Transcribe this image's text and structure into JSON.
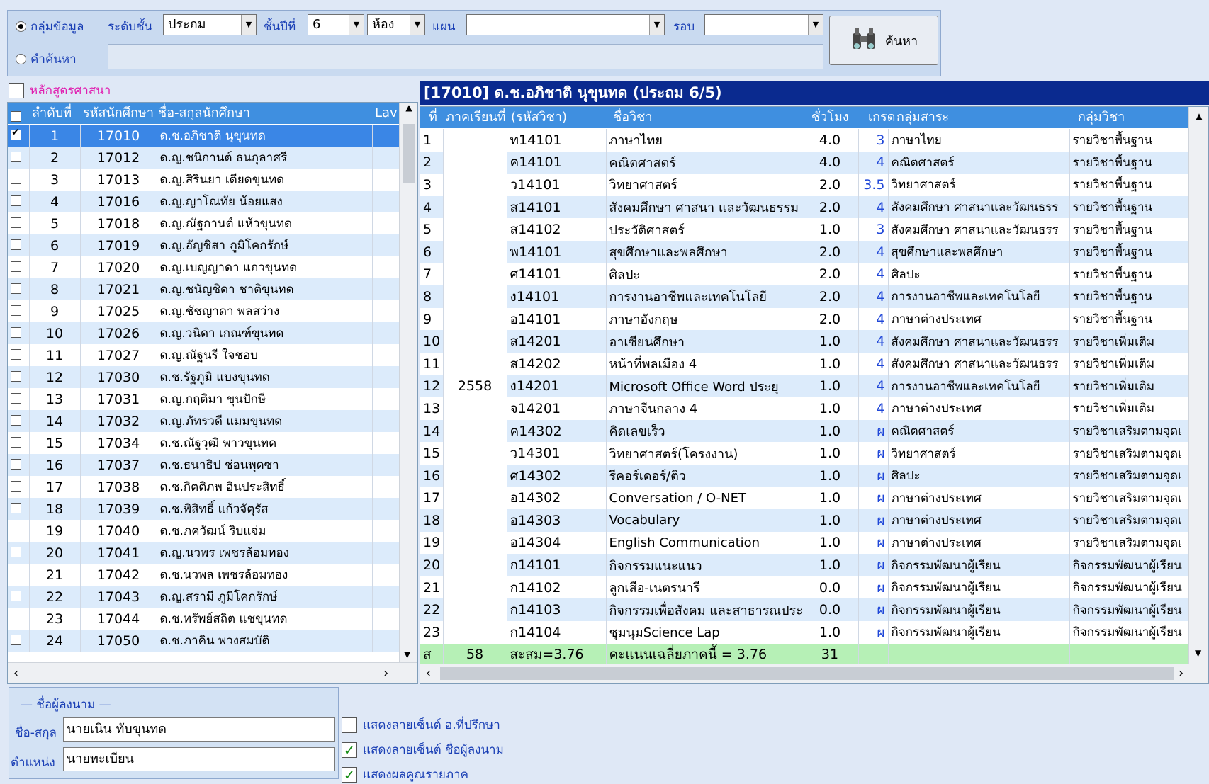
{
  "filter": {
    "group_radio": "กลุ่มข้อมูล",
    "level_label": "ระดับชั้น",
    "level_value": "ประถม",
    "grade_label": "ชั้นปีที่",
    "grade_value": "6",
    "room_value": "ห้อง",
    "plan_label": "แผน",
    "plan_value": "",
    "round_label": "รอบ",
    "round_value": "",
    "keyword_radio": "คำค้นหา",
    "keyword_value": "",
    "search_button": "ค้นหา"
  },
  "left": {
    "religion_check": "หลักสูตรศาสนา",
    "headers": [
      "ลำดับที่",
      "รหัสนักศึกษา",
      "ชื่อ-สกุลนักศึกษา",
      "Lav"
    ],
    "students": [
      {
        "no": "1",
        "id": "17010",
        "name": "ด.ช.อภิชาติ นุขุนทด",
        "checked": true
      },
      {
        "no": "2",
        "id": "17012",
        "name": "ด.ญ.ชนิกานต์ ธนกุลาศรี",
        "checked": false
      },
      {
        "no": "3",
        "id": "17013",
        "name": "ด.ญ.สิรินยา เตียดขุนทด",
        "checked": false
      },
      {
        "no": "4",
        "id": "17016",
        "name": "ด.ญ.ญาโณทัย น้อยแสง",
        "checked": false
      },
      {
        "no": "5",
        "id": "17018",
        "name": "ด.ญ.ณัฐกานต์ แห้วขุนทด",
        "checked": false
      },
      {
        "no": "6",
        "id": "17019",
        "name": "ด.ญ.อัญชิสา ภูมิโคกรักษ์",
        "checked": false
      },
      {
        "no": "7",
        "id": "17020",
        "name": "ด.ญ.เบญญาดา แถวขุนทด",
        "checked": false
      },
      {
        "no": "8",
        "id": "17021",
        "name": "ด.ญ.ชนัญชิดา ชาติขุนทด",
        "checked": false
      },
      {
        "no": "9",
        "id": "17025",
        "name": "ด.ญ.ชัชญาดา พลสว่าง",
        "checked": false
      },
      {
        "no": "10",
        "id": "17026",
        "name": "ด.ญ.วนิดา เกณฑ์ขุนทด",
        "checked": false
      },
      {
        "no": "11",
        "id": "17027",
        "name": "ด.ญ.ณัฐนรี ใจชอบ",
        "checked": false
      },
      {
        "no": "12",
        "id": "17030",
        "name": "ด.ช.รัฐภูมิ แบงขุนทด",
        "checked": false
      },
      {
        "no": "13",
        "id": "17031",
        "name": "ด.ญ.กฤติมา ขุนปักษี",
        "checked": false
      },
      {
        "no": "14",
        "id": "17032",
        "name": "ด.ญ.ภัทรวดี แมมขุนทด",
        "checked": false
      },
      {
        "no": "15",
        "id": "17034",
        "name": "ด.ช.ณัฐวุฒิ พาวขุนทด",
        "checked": false
      },
      {
        "no": "16",
        "id": "17037",
        "name": "ด.ช.ธนาธิป ช่อนพุดซา",
        "checked": false
      },
      {
        "no": "17",
        "id": "17038",
        "name": "ด.ช.กิตติภพ อินประสิทธิ์",
        "checked": false
      },
      {
        "no": "18",
        "id": "17039",
        "name": "ด.ช.พิสิทธิ์ แก้วจัตุรัส",
        "checked": false
      },
      {
        "no": "19",
        "id": "17040",
        "name": "ด.ช.ภควัฒน์ ริบแจ่ม",
        "checked": false
      },
      {
        "no": "20",
        "id": "17041",
        "name": "ด.ญ.นวพร เพชรล้อมทอง",
        "checked": false
      },
      {
        "no": "21",
        "id": "17042",
        "name": "ด.ช.นวพล เพชรล้อมทอง",
        "checked": false
      },
      {
        "no": "22",
        "id": "17043",
        "name": "ด.ญ.สรามี ภูมิโคกรักษ์",
        "checked": false
      },
      {
        "no": "23",
        "id": "17044",
        "name": "ด.ช.ทรัพย์สถิต แชขุนทด",
        "checked": false
      },
      {
        "no": "24",
        "id": "17050",
        "name": "ด.ช.ภาคิน พวงสมบัติ",
        "checked": false
      }
    ]
  },
  "right": {
    "title": "[17010] ด.ช.อภิชาติ นุขุนทด (ประถม 6/5)",
    "headers": [
      "ที่",
      "ภาคเรียนที่",
      "(รหัสวิชา)",
      "ชื่อวิชา",
      "ชั่วโมง",
      "เกรด",
      "กลุ่มสาระ",
      "กลุ่มวิชา"
    ],
    "year": "2558",
    "rows": [
      {
        "no": "1",
        "code": "ท14101",
        "name": "ภาษาไทย",
        "hours": "4.0",
        "grade": "3",
        "area": "ภาษาไทย",
        "group": "รายวิชาพื้นฐาน"
      },
      {
        "no": "2",
        "code": "ค14101",
        "name": "คณิตศาสตร์",
        "hours": "4.0",
        "grade": "4",
        "area": "คณิตศาสตร์",
        "group": "รายวิชาพื้นฐาน"
      },
      {
        "no": "3",
        "code": "ว14101",
        "name": "วิทยาศาสตร์",
        "hours": "2.0",
        "grade": "3.5",
        "area": "วิทยาศาสตร์",
        "group": "รายวิชาพื้นฐาน"
      },
      {
        "no": "4",
        "code": "ส14101",
        "name": "สังคมศึกษา ศาสนา และวัฒนธรรม",
        "hours": "2.0",
        "grade": "4",
        "area": "สังคมศึกษา ศาสนาและวัฒนธรร",
        "group": "รายวิชาพื้นฐาน"
      },
      {
        "no": "5",
        "code": "ส14102",
        "name": "ประวัติศาสตร์",
        "hours": "1.0",
        "grade": "3",
        "area": "สังคมศึกษา ศาสนาและวัฒนธรร",
        "group": "รายวิชาพื้นฐาน"
      },
      {
        "no": "6",
        "code": "พ14101",
        "name": "สุขศึกษาและพลศึกษา",
        "hours": "2.0",
        "grade": "4",
        "area": "สุขศึกษาและพลศึกษา",
        "group": "รายวิชาพื้นฐาน"
      },
      {
        "no": "7",
        "code": "ศ14101",
        "name": "ศิลปะ",
        "hours": "2.0",
        "grade": "4",
        "area": "ศิลปะ",
        "group": "รายวิชาพื้นฐาน"
      },
      {
        "no": "8",
        "code": "ง14101",
        "name": "การงานอาชีพและเทคโนโลยี",
        "hours": "2.0",
        "grade": "4",
        "area": "การงานอาชีพและเทคโนโลยี",
        "group": "รายวิชาพื้นฐาน"
      },
      {
        "no": "9",
        "code": "อ14101",
        "name": "ภาษาอังกฤษ",
        "hours": "2.0",
        "grade": "4",
        "area": "ภาษาต่างประเทศ",
        "group": "รายวิชาพื้นฐาน"
      },
      {
        "no": "10",
        "code": "ส14201",
        "name": "อาเซียนศึกษา",
        "hours": "1.0",
        "grade": "4",
        "area": "สังคมศึกษา ศาสนาและวัฒนธรร",
        "group": "รายวิชาเพิ่มเติม"
      },
      {
        "no": "11",
        "code": "ส14202",
        "name": "หน้าที่พลเมือง 4",
        "hours": "1.0",
        "grade": "4",
        "area": "สังคมศึกษา ศาสนาและวัฒนธรร",
        "group": "รายวิชาเพิ่มเติม"
      },
      {
        "no": "12",
        "code": "ง14201",
        "name": "Microsoft Office Word ประยุ",
        "hours": "1.0",
        "grade": "4",
        "area": "การงานอาชีพและเทคโนโลยี",
        "group": "รายวิชาเพิ่มเติม"
      },
      {
        "no": "13",
        "code": "จ14201",
        "name": "ภาษาจีนกลาง 4",
        "hours": "1.0",
        "grade": "4",
        "area": "ภาษาต่างประเทศ",
        "group": "รายวิชาเพิ่มเติม"
      },
      {
        "no": "14",
        "code": "ค14302",
        "name": "คิดเลขเร็ว",
        "hours": "1.0",
        "grade": "ผ",
        "area": "คณิตศาสตร์",
        "group": "รายวิชาเสริมตามจุดเ"
      },
      {
        "no": "15",
        "code": "ว14301",
        "name": "วิทยาศาสตร์(โครงงาน)",
        "hours": "1.0",
        "grade": "ผ",
        "area": "วิทยาศาสตร์",
        "group": "รายวิชาเสริมตามจุดเ"
      },
      {
        "no": "16",
        "code": "ศ14302",
        "name": "รีคอร์เดอร์/ติว",
        "hours": "1.0",
        "grade": "ผ",
        "area": "ศิลปะ",
        "group": "รายวิชาเสริมตามจุดเ"
      },
      {
        "no": "17",
        "code": "อ14302",
        "name": "Conversation / O-NET",
        "hours": "1.0",
        "grade": "ผ",
        "area": "ภาษาต่างประเทศ",
        "group": "รายวิชาเสริมตามจุดเ"
      },
      {
        "no": "18",
        "code": "อ14303",
        "name": "Vocabulary",
        "hours": "1.0",
        "grade": "ผ",
        "area": "ภาษาต่างประเทศ",
        "group": "รายวิชาเสริมตามจุดเ"
      },
      {
        "no": "19",
        "code": "อ14304",
        "name": "English Communication",
        "hours": "1.0",
        "grade": "ผ",
        "area": "ภาษาต่างประเทศ",
        "group": "รายวิชาเสริมตามจุดเ"
      },
      {
        "no": "20",
        "code": "ก14101",
        "name": "กิจกรรมแนะแนว",
        "hours": "1.0",
        "grade": "ผ",
        "area": "กิจกรรมพัฒนาผู้เรียน",
        "group": "กิจกรรมพัฒนาผู้เรียน"
      },
      {
        "no": "21",
        "code": "ก14102",
        "name": "ลูกเสือ-เนตรนารี",
        "hours": "0.0",
        "grade": "ผ",
        "area": "กิจกรรมพัฒนาผู้เรียน",
        "group": "กิจกรรมพัฒนาผู้เรียน"
      },
      {
        "no": "22",
        "code": "ก14103",
        "name": "กิจกรรมเพื่อสังคม และสาธารณประ",
        "hours": "0.0",
        "grade": "ผ",
        "area": "กิจกรรมพัฒนาผู้เรียน",
        "group": "กิจกรรมพัฒนาผู้เรียน"
      },
      {
        "no": "23",
        "code": "ก14104",
        "name": "ชุมนุมScience Lap",
        "hours": "1.0",
        "grade": "ผ",
        "area": "กิจกรรมพัฒนาผู้เรียน",
        "group": "กิจกรรมพัฒนาผู้เรียน"
      }
    ],
    "total": {
      "no": "ส",
      "sem": "58",
      "code": "สะสม=3.76",
      "name": "คะแนนเฉลี่ยภาคนี้ = 3.76",
      "hours": "31"
    }
  },
  "signer": {
    "legend": "— ชื่อผู้ลงนาม —",
    "name_label": "ชื่อ-สกุล",
    "name_value": "นายเนิน ทับขุนทด",
    "position_label": "ตำแหน่ง",
    "position_value": "นายทะเบียน"
  },
  "options": {
    "advisor_sign": "แสดงลายเซ็นต์ อ.ที่ปรึกษา",
    "signer_sign": "แสดงลายเซ็นต์ ชื่อผู้ลงนาม",
    "term_result": "แสดงผลคูณรายภาค"
  }
}
